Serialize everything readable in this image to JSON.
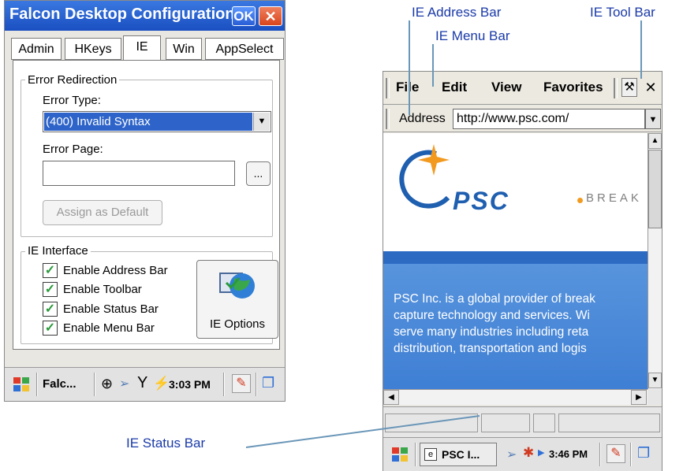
{
  "left_window": {
    "title": "Falcon Desktop Configuration",
    "ok_label": "OK",
    "close_label": "✕",
    "tabs": [
      "Admin",
      "HKeys",
      "IE",
      "Win",
      "AppSelect"
    ],
    "error_redirection": {
      "group_label": "Error Redirection",
      "error_type_label": "Error Type:",
      "error_type_value": "(400) Invalid Syntax",
      "error_page_label": "Error Page:",
      "error_page_value": "",
      "browse_label": "...",
      "assign_label": "Assign as Default"
    },
    "ie_interface": {
      "group_label": "IE Interface",
      "checkboxes": [
        {
          "label": "Enable Address Bar",
          "checked": true
        },
        {
          "label": "Enable Toolbar",
          "checked": true
        },
        {
          "label": "Enable Status Bar",
          "checked": true
        },
        {
          "label": "Enable Menu Bar",
          "checked": true
        }
      ],
      "options_label": "IE Options"
    },
    "taskbar": {
      "app_label": "Falc...",
      "time": "3:03 PM"
    }
  },
  "right_window": {
    "menu": [
      "File",
      "Edit",
      "View",
      "Favorites"
    ],
    "close_label": "✕",
    "address_label": "Address",
    "address_value": "http://www.psc.com/",
    "page": {
      "logo_text": "PSC",
      "tagline": "BREAK",
      "body_lines": [
        "PSC Inc. is a global provider of break",
        "capture technology and services. Wi",
        "serve many industries including reta",
        "distribution, transportation and logis"
      ]
    },
    "taskbar": {
      "app_label": "PSC I...",
      "time": "3:46 PM"
    }
  },
  "callouts": {
    "address_bar": "IE Address Bar",
    "menu_bar": "IE Menu Bar",
    "tool_bar": "IE Tool Bar",
    "status_bar": "IE Status Bar"
  },
  "colors": {
    "title_blue": "#1a4fc1",
    "selection_blue": "#2e64c9",
    "callout_text": "#1a3aa8",
    "check_green": "#2a9a3a"
  }
}
